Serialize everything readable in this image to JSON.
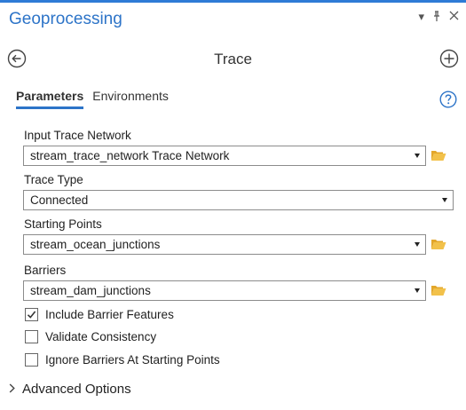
{
  "panel": {
    "title": "Geoprocessing",
    "menu_icon": "dropdown-menu-icon",
    "pin_icon": "pin-icon",
    "close_icon": "close-icon"
  },
  "tool": {
    "title": "Trace",
    "back_icon": "back-arrow-icon",
    "add_icon": "add-icon"
  },
  "tabs": [
    {
      "label": "Parameters",
      "active": true
    },
    {
      "label": "Environments",
      "active": false
    }
  ],
  "help_icon": "help-icon",
  "params": {
    "input_trace_network": {
      "label": "Input Trace Network",
      "value": "stream_trace_network Trace Network"
    },
    "trace_type": {
      "label": "Trace Type",
      "value": "Connected"
    },
    "starting_points": {
      "label": "Starting Points",
      "value": "stream_ocean_junctions"
    },
    "barriers": {
      "label": "Barriers",
      "value": "stream_dam_junctions"
    }
  },
  "checkboxes": [
    {
      "label": "Include Barrier Features",
      "checked": true
    },
    {
      "label": "Validate Consistency",
      "checked": false
    },
    {
      "label": "Ignore Barriers At Starting Points",
      "checked": false
    }
  ],
  "advanced": {
    "label": "Advanced Options"
  },
  "colors": {
    "accent": "#2d74c8",
    "folder": "#f2c14a"
  }
}
